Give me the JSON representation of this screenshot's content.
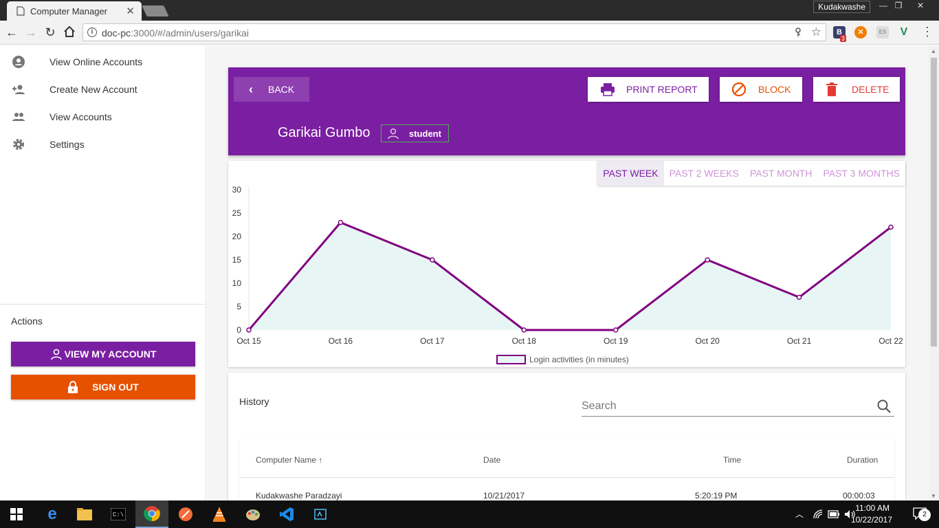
{
  "browser": {
    "tab_title": "Computer Manager",
    "profile_name": "Kudakwashe",
    "url_host": "doc-pc",
    "url_rest": ":3000/#/admin/users/garikai",
    "extension_badge": "3"
  },
  "sidebar": {
    "items": [
      {
        "label": "View Online Accounts",
        "icon": "account-circle-icon"
      },
      {
        "label": "Create New Account",
        "icon": "person-add-icon"
      },
      {
        "label": "View Accounts",
        "icon": "people-icon"
      },
      {
        "label": "Settings",
        "icon": "gear-icon"
      }
    ],
    "actions_label": "Actions",
    "view_account_label": "VIEW MY ACCOUNT",
    "sign_out_label": "SIGN OUT"
  },
  "header": {
    "back_label": "BACK",
    "print_label": "PRINT REPORT",
    "block_label": "BLOCK",
    "delete_label": "DELETE",
    "user_name": "Garikai Gumbo",
    "role": "student",
    "colors": {
      "primary": "#7b1fa2",
      "block": "#e65100",
      "delete": "#e53935",
      "chip_border": "#4caf50"
    }
  },
  "range_tabs": [
    {
      "label": "PAST WEEK",
      "active": true
    },
    {
      "label": "PAST 2 WEEKS",
      "active": false
    },
    {
      "label": "PAST MONTH",
      "active": false
    },
    {
      "label": "PAST 3 MONTHS",
      "active": false
    }
  ],
  "chart_data": {
    "type": "area",
    "categories": [
      "Oct 15",
      "Oct 16",
      "Oct 17",
      "Oct 18",
      "Oct 19",
      "Oct 20",
      "Oct 21",
      "Oct 22"
    ],
    "series": [
      {
        "name": "Login activities (in minutes)",
        "values": [
          0,
          23,
          15,
          0,
          0,
          15,
          7,
          22
        ],
        "line_color": "#800080",
        "fill_color": "#e8f5f5"
      }
    ],
    "ylim": [
      0,
      30
    ],
    "yticks": [
      0,
      5,
      10,
      15,
      20,
      25,
      30
    ],
    "grid": false,
    "legend": "bottom"
  },
  "history": {
    "title": "History",
    "search_placeholder": "Search",
    "columns": [
      "Computer Name",
      "Date",
      "Time",
      "Duration"
    ],
    "sort_indicator": "↑",
    "rows": [
      {
        "computer": "Kudakwashe Paradzayi",
        "date": "10/21/2017",
        "time": "5:20:19 PM",
        "duration": "00:00:03"
      }
    ]
  },
  "taskbar": {
    "time": "11:00 AM",
    "date": "10/22/2017",
    "notifications": "2"
  }
}
